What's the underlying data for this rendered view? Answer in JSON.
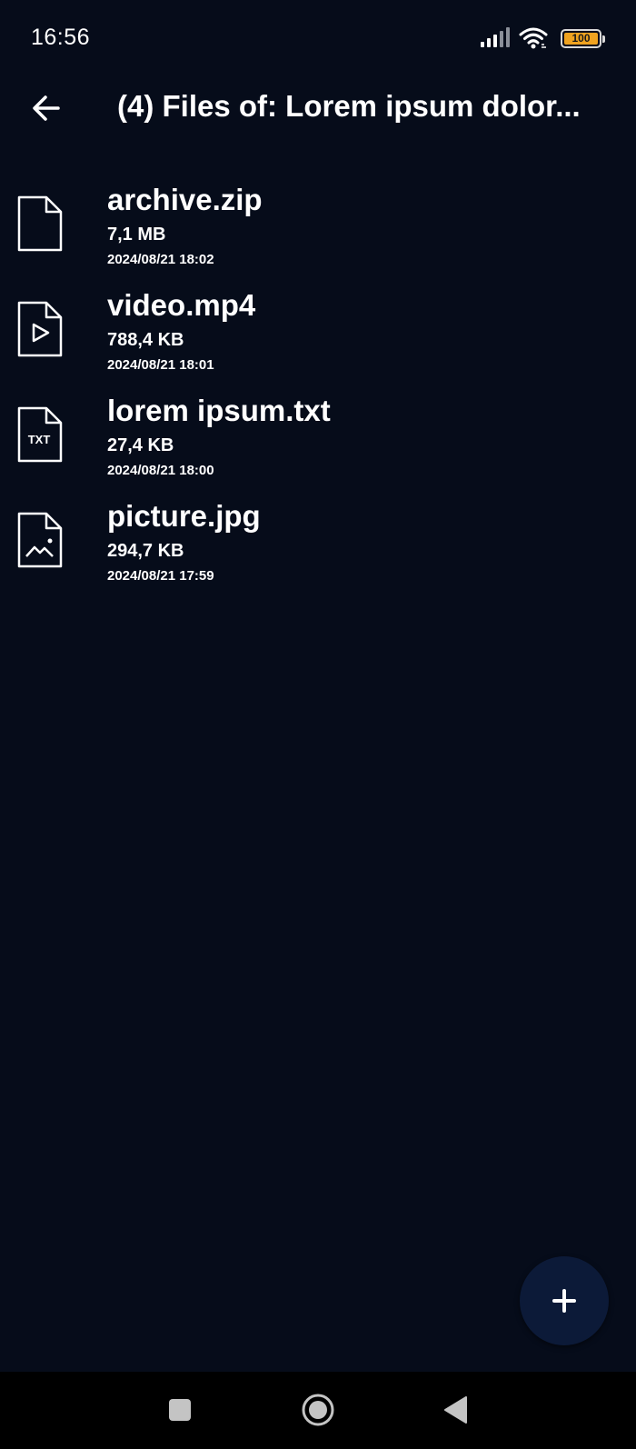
{
  "status_bar": {
    "time": "16:56",
    "battery_level": "100",
    "battery_color": "#f0a320",
    "icons": [
      "signal-icon",
      "wifi-icon",
      "battery-icon"
    ]
  },
  "app_bar": {
    "back_icon": "arrow-left-icon",
    "title": "(4) Files of: Lorem ipsum dolor..."
  },
  "files": [
    {
      "name": "archive.zip",
      "size": "7,1 MB",
      "date": "2024/08/21 18:02",
      "icon": "file-icon"
    },
    {
      "name": "video.mp4",
      "size": "788,4 KB",
      "date": "2024/08/21 18:01",
      "icon": "video-file-icon"
    },
    {
      "name": "lorem ipsum.txt",
      "size": "27,4 KB",
      "date": "2024/08/21 18:00",
      "icon": "text-file-icon",
      "icon_text": "TXT"
    },
    {
      "name": "picture.jpg",
      "size": "294,7 KB",
      "date": "2024/08/21 17:59",
      "icon": "image-file-icon"
    }
  ],
  "fab": {
    "icon": "plus-icon",
    "color": "#0c1a38"
  },
  "nav_bar": {
    "items": [
      "recents-square-icon",
      "home-circle-icon",
      "back-triangle-icon"
    ]
  },
  "colors": {
    "background": "#060c1a",
    "text": "#ffffff",
    "nav_background": "#000000"
  }
}
